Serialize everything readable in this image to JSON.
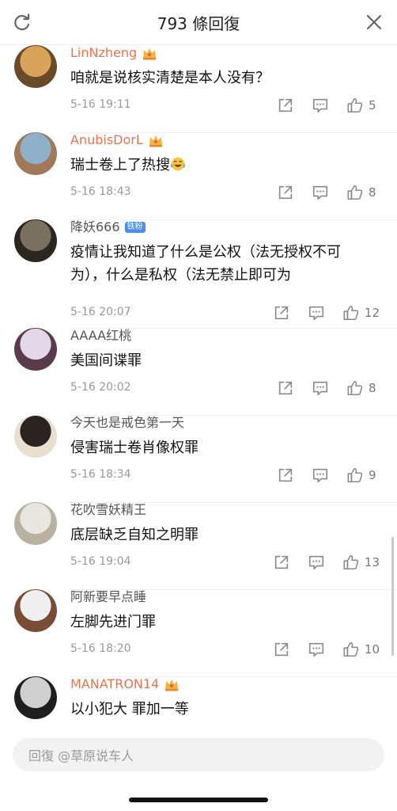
{
  "header": {
    "title": "793 條回復",
    "refresh_icon": "refresh-icon",
    "close_icon": "close-icon"
  },
  "comments": [
    {
      "user": "LinNzheng",
      "vip": true,
      "badge": null,
      "text": "咱就是说核实清楚是本人没有？",
      "emoji": null,
      "time": "5-16 19:11",
      "likes": "5",
      "avatar_colors": [
        "#d9a45a",
        "#6b4a2a"
      ]
    },
    {
      "user": "AnubisDorL",
      "vip": true,
      "badge": null,
      "text": "瑞士卷上了热搜",
      "emoji": "laughing-crying-emoji",
      "time": "5-16 18:43",
      "likes": "8",
      "avatar_colors": [
        "#8fb0c9",
        "#a1795a"
      ]
    },
    {
      "user": "降妖666",
      "vip": false,
      "badge": "铁粉",
      "text": "疫情让我知道了什么是公权（法无授权不可为），什么是私权（法无禁止即可为",
      "emoji": null,
      "time": "5-16 20:07",
      "likes": "12",
      "avatar_colors": [
        "#7a7060",
        "#2b2620"
      ]
    },
    {
      "user": "AAAA红桃",
      "vip": false,
      "badge": null,
      "text": "美国间谍罪",
      "emoji": null,
      "time": "5-16 20:02",
      "likes": "8",
      "avatar_colors": [
        "#e3d7ea",
        "#5a3b4a"
      ]
    },
    {
      "user": "今天也是戒色第一天",
      "vip": false,
      "badge": null,
      "text": "侵害瑞士卷肖像权罪",
      "emoji": null,
      "time": "5-16 18:34",
      "likes": "9",
      "avatar_colors": [
        "#2a2420",
        "#e9dfd0"
      ]
    },
    {
      "user": "花吹雪妖精王",
      "vip": false,
      "badge": null,
      "text": "底层缺乏自知之明罪",
      "emoji": null,
      "time": "5-16 19:04",
      "likes": "13",
      "avatar_colors": [
        "#e8e6df",
        "#b9b2a2"
      ]
    },
    {
      "user": "阿新要早点睡",
      "vip": false,
      "badge": null,
      "text": "左脚先进门罪",
      "emoji": null,
      "time": "5-16 18:20",
      "likes": "10",
      "avatar_colors": [
        "#efefef",
        "#7a4b35"
      ]
    },
    {
      "user": "MANATRON14",
      "vip": true,
      "badge": null,
      "text": "以小犯大 罪加一等",
      "emoji": null,
      "time": "",
      "likes": "",
      "avatar_colors": [
        "#cfcfcf",
        "#1e1e1e"
      ]
    }
  ],
  "reply": {
    "placeholder": "回復 @草原说车人"
  },
  "colors": {
    "vip_name": "#eb7350",
    "icon_gray": "#8a8a8a",
    "time_gray": "#999999"
  }
}
